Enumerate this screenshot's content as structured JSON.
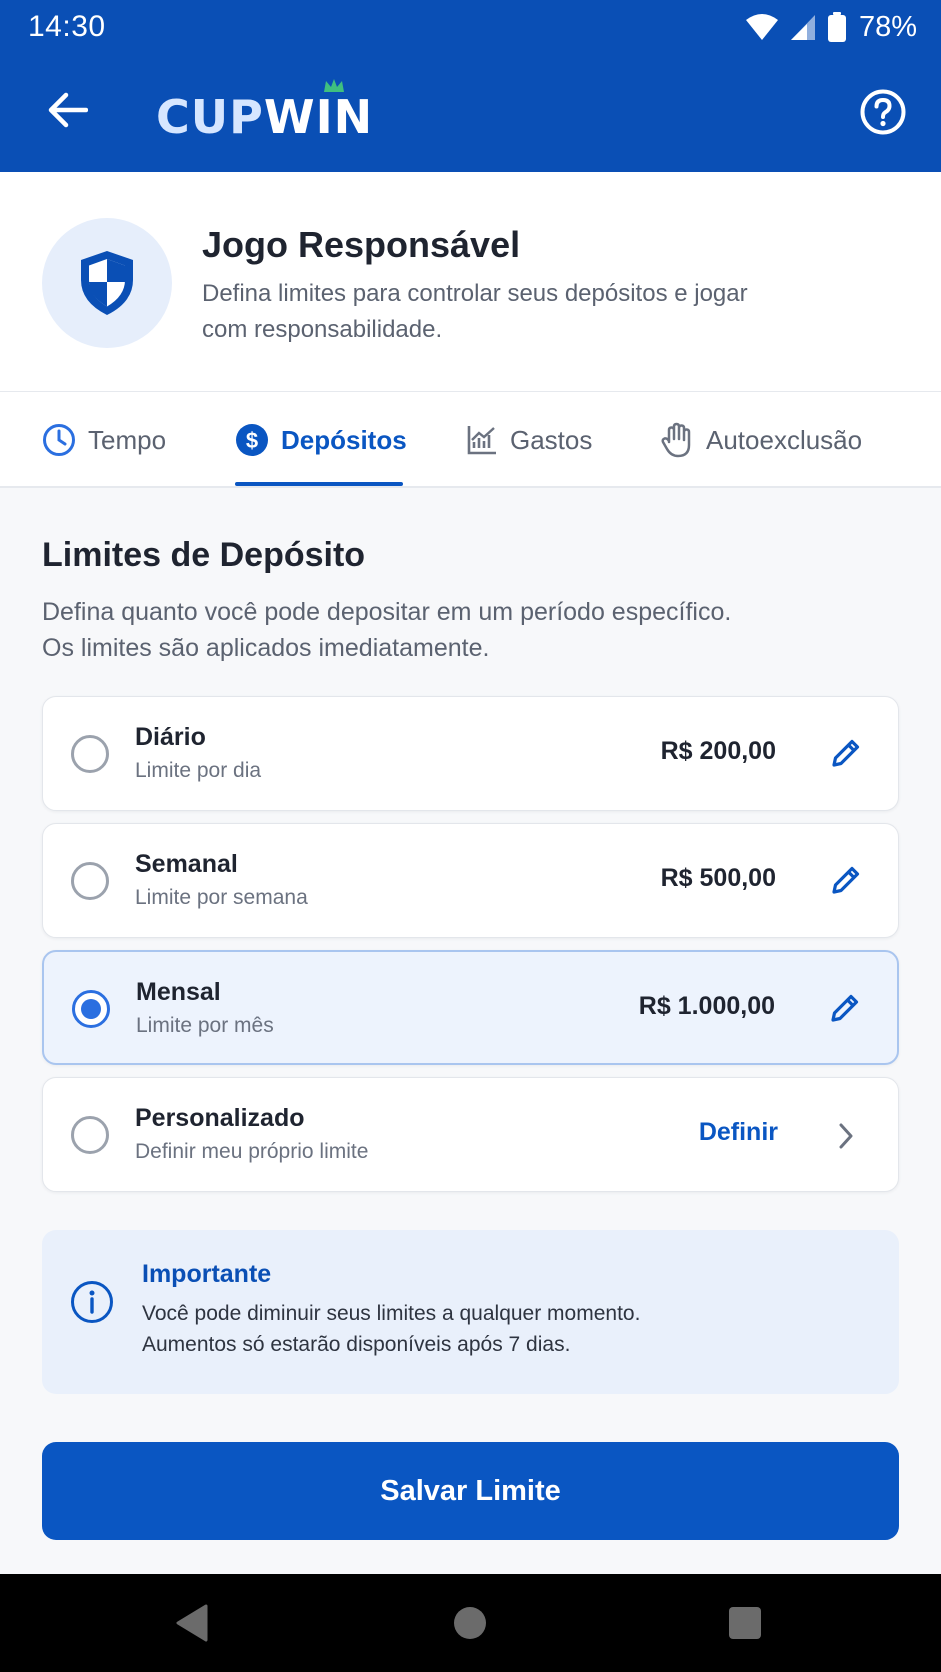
{
  "status_bar": {
    "time": "14:30",
    "battery": "78%",
    "icons": [
      "wifi-icon",
      "signal-icon",
      "battery-icon"
    ]
  },
  "header": {
    "logo_part1": "CUP",
    "logo_part2": "WIN",
    "icons": [
      "back-arrow-icon",
      "crown-icon",
      "help-icon"
    ]
  },
  "intro": {
    "title": "Jogo Responsável",
    "description": "Defina limites para controlar seus depósitos e jogar com responsabilidade.",
    "icon": "shield-icon"
  },
  "tabs": [
    {
      "label": "Tempo",
      "icon": "clock-icon",
      "active": false
    },
    {
      "label": "Depósitos",
      "icon": "dollar-icon",
      "active": true
    },
    {
      "label": "Gastos",
      "icon": "chart-icon",
      "active": false
    },
    {
      "label": "Autoexclusão",
      "icon": "hand-icon",
      "active": false
    }
  ],
  "section": {
    "title": "Limites de Depósito",
    "description_line1": "Defina quanto você pode depositar em um período específico.",
    "description_line2": "Os limites são aplicados imediatamente."
  },
  "options": [
    {
      "name": "Diário",
      "subtitle": "Limite por dia",
      "value": "R$ 200,00",
      "selected": false
    },
    {
      "name": "Semanal",
      "subtitle": "Limite por semana",
      "value": "R$ 500,00",
      "selected": false
    },
    {
      "name": "Mensal",
      "subtitle": "Limite por mês",
      "value": "R$ 1.000,00",
      "selected": true
    },
    {
      "name": "Personalizado",
      "subtitle": "Definir meu próprio limite",
      "action": "Definir",
      "selected": false
    }
  ],
  "info": {
    "title": "Importante",
    "line1": "Você pode diminuir seus limites a qualquer momento.",
    "line2": "Aumentos só estarão disponíveis após 7 dias.",
    "icon": "info-icon"
  },
  "save_button": {
    "label": "Salvar Limite"
  },
  "colors": {
    "primary": "#0a4fb5",
    "accent": "#0a56c2",
    "selected_bg": "#edf3fd",
    "radio_checked": "#2b6fe0"
  }
}
